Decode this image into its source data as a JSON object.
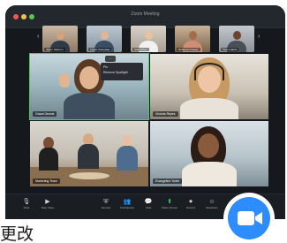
{
  "window": {
    "title": "Zoom Meeting"
  },
  "thumbnails": [
    {
      "name": "Jason Harmon"
    },
    {
      "name": "Logan Vereyweg"
    },
    {
      "name": "Nikki Chan"
    },
    {
      "name": "Rebecca Cooper"
    },
    {
      "name": "Tyron Harris"
    }
  ],
  "tiles": [
    {
      "name": "Grace Dennis"
    },
    {
      "name": "Victoria Reyes"
    },
    {
      "name": "Marketing Team"
    },
    {
      "name": "Evangeline Yoder"
    }
  ],
  "menu": {
    "more_label": "...",
    "items": [
      "Pin",
      "Remove Spotlight"
    ]
  },
  "toolbar": {
    "items": [
      {
        "label": "Mute",
        "icon": "microphone-icon"
      },
      {
        "label": "Stop Video",
        "icon": "video-camera-icon"
      },
      {
        "label": "Security",
        "icon": "shield-icon"
      },
      {
        "label": "Participants",
        "icon": "participants-icon"
      },
      {
        "label": "Chat",
        "icon": "chat-icon"
      },
      {
        "label": "Share Screen",
        "icon": "share-screen-icon"
      },
      {
        "label": "Record",
        "icon": "record-icon"
      },
      {
        "label": "Reactions",
        "icon": "reactions-icon"
      },
      {
        "label": "End",
        "icon": "end-call-icon"
      }
    ]
  },
  "caption": "更改",
  "colors": {
    "zoom_blue": "#2d8cff",
    "active_speaker": "#3ad35a"
  }
}
